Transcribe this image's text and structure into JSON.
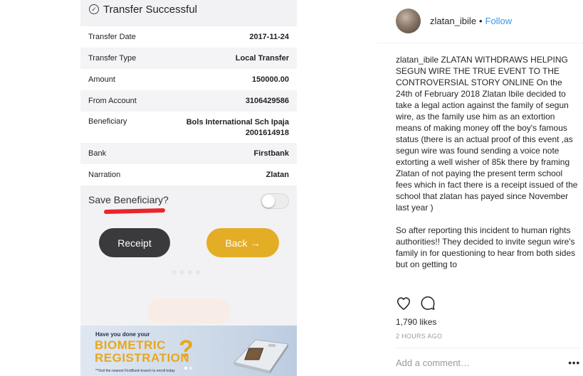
{
  "screenshot": {
    "header_title": "Transfer Successful",
    "rows": [
      {
        "label": "Transfer Date",
        "value": "2017-11-24"
      },
      {
        "label": "Transfer Type",
        "value": "Local Transfer"
      },
      {
        "label": "Amount",
        "value": "150000.00"
      },
      {
        "label": "From Account",
        "value": "3106429586"
      },
      {
        "label": "Beneficiary",
        "value": "Bols International Sch Ipaja",
        "value_line2": "2001614918"
      },
      {
        "label": "Bank",
        "value": "Firstbank"
      },
      {
        "label": "Narration",
        "value": "Zlatan"
      }
    ],
    "save_beneficiary_label": "Save Beneficiary?",
    "save_beneficiary_on": false,
    "receipt_label": "Receipt",
    "back_label": "Back",
    "back_arrow": "→",
    "banner": {
      "question": "Have you done your",
      "title_line1": "BIOMETRIC",
      "title_line2": "REGISTRATION",
      "qmark": "?",
      "footnote": "**Visit the nearest FirstBank branch to enroll today"
    },
    "accent_red": "#e8262c",
    "accent_gold": "#e3ad25"
  },
  "post": {
    "author": "zlatan_ibile",
    "separator": "•",
    "follow_label": "Follow",
    "caption_author": "zlatan_ibile",
    "caption_paragraph_1": "ZLATAN WITHDRAWS HELPING SEGUN WIRE THE TRUE EVENT TO THE CONTROVERSIAL STORY ONLINE On the 24th of February 2018 Zlatan Ibile decided to take a legal action against the family of segun wire, as the family use him as an extortion means of making money off the boy's famous status (there is an actual proof of this event ,as segun wire was found sending a voice note extorting a well wisher of 85k there by framing Zlatan of not paying the present term school fees which in fact there is a receipt issued of the school that zlatan has payed since November last year )",
    "caption_paragraph_2": "So after reporting this incident to human rights authorities!! They decided to invite segun wire's family in for questioning to hear from both sides but on getting to",
    "likes": "1,790 likes",
    "timestamp": "2 HOURS AGO",
    "comment_placeholder": "Add a comment…",
    "more_options": "•••",
    "link_color": "#3897f0"
  }
}
